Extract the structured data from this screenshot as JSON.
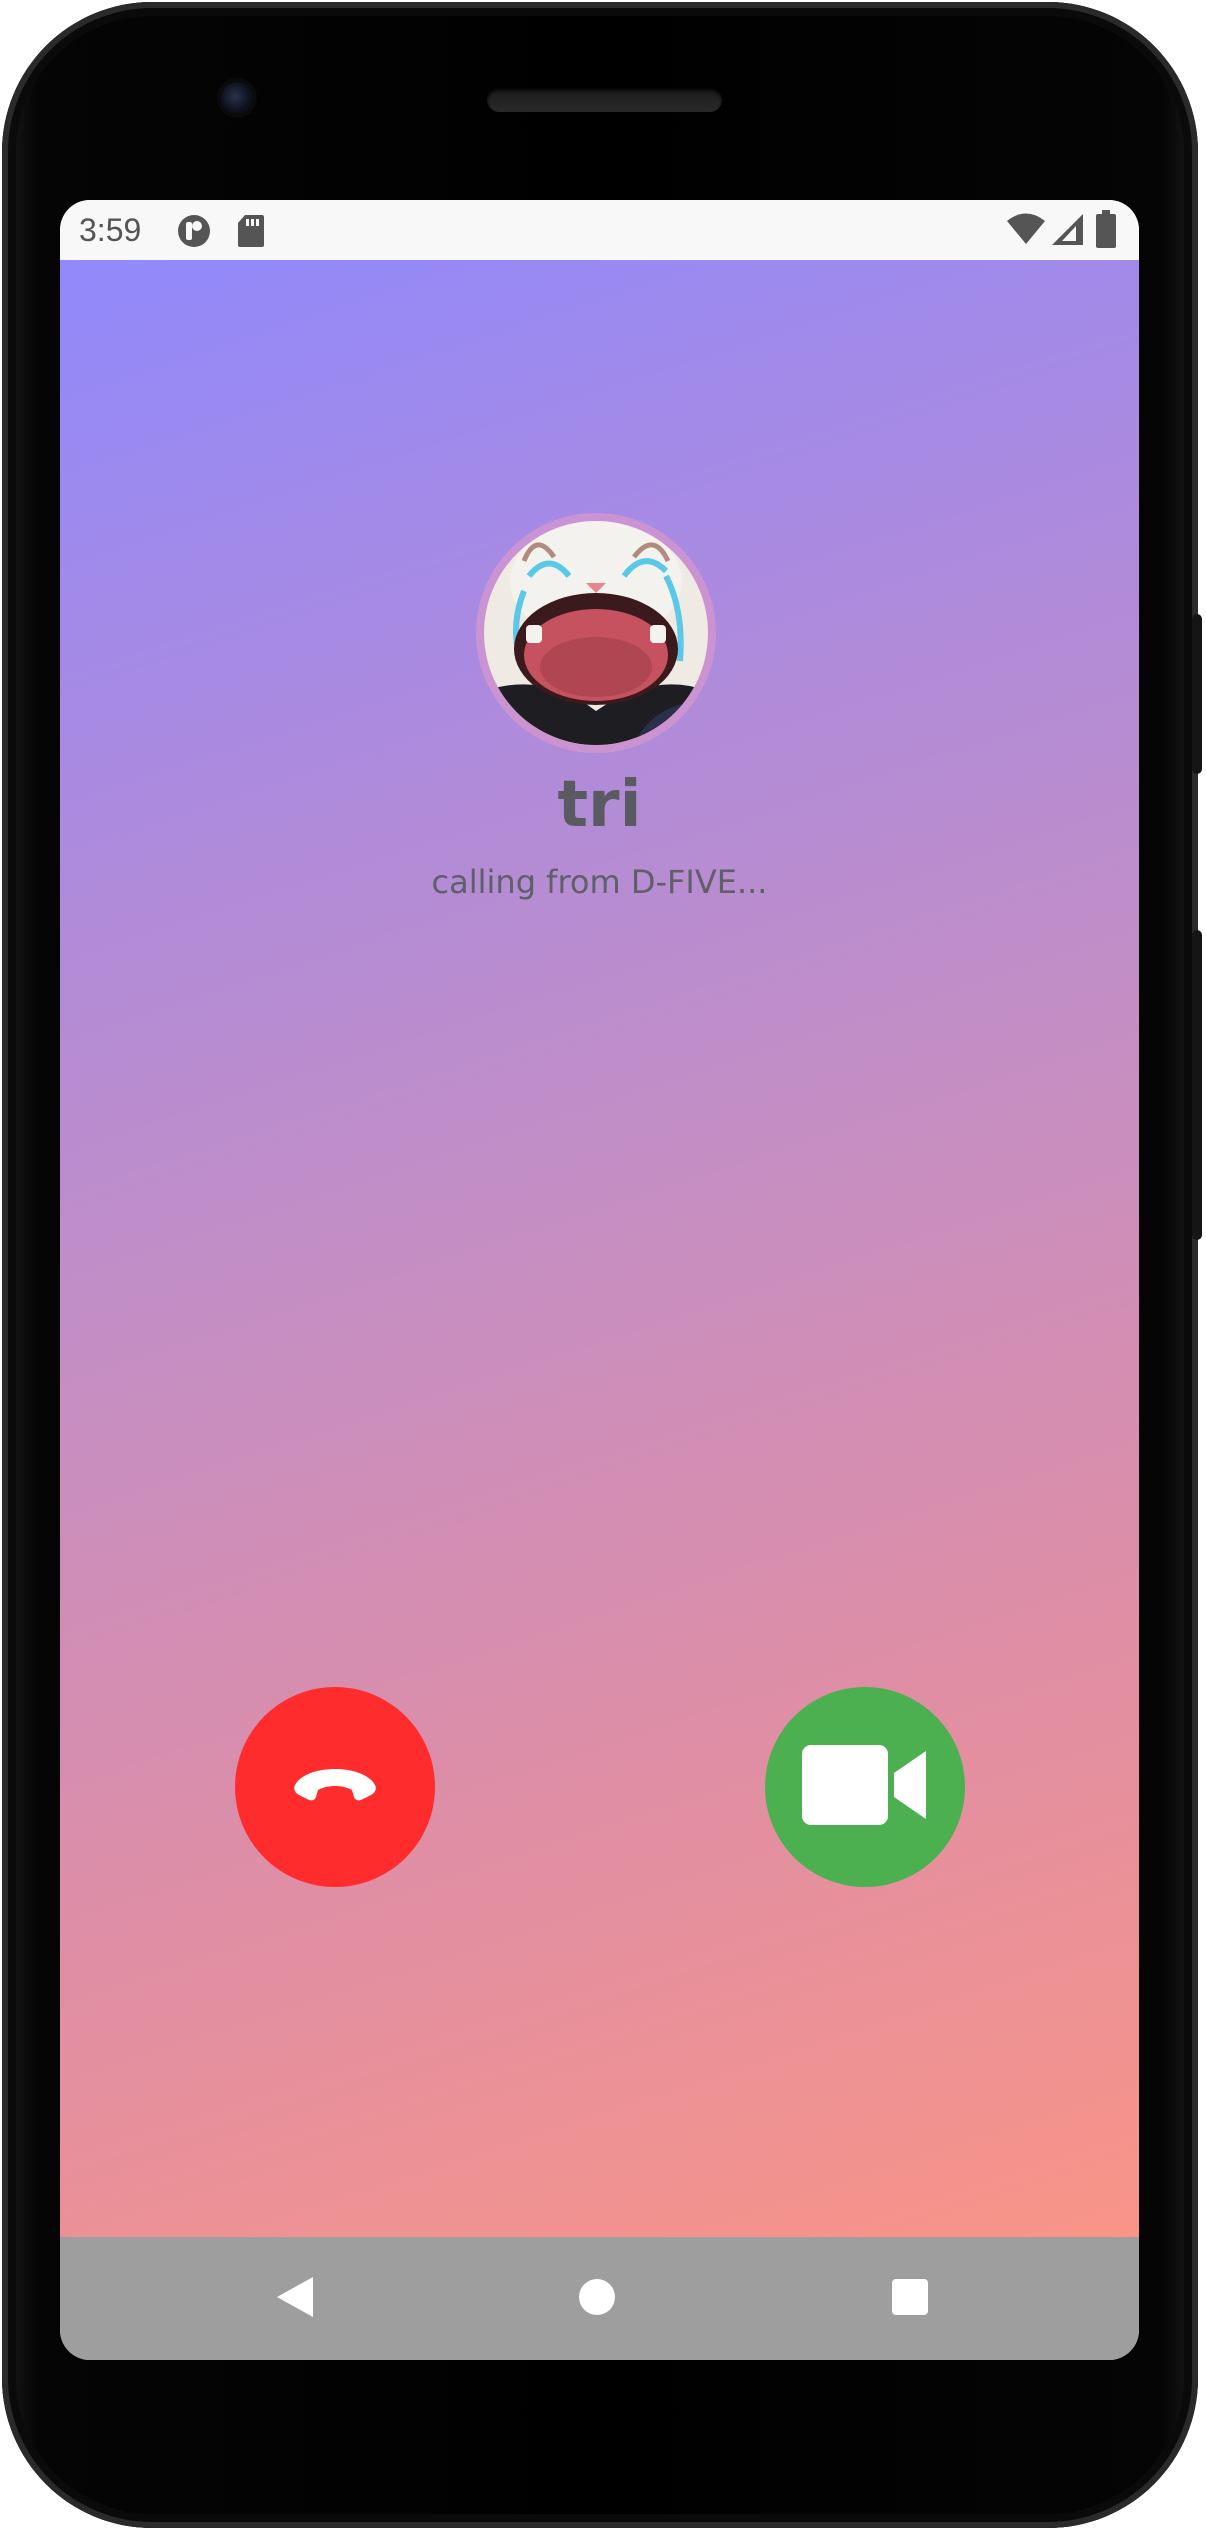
{
  "status_bar": {
    "time": "3:59",
    "icons": [
      "launcher-app-icon",
      "sd-card-icon",
      "wifi-icon",
      "signal-icon",
      "battery-icon"
    ]
  },
  "call": {
    "caller_name": "tri",
    "subtitle": "calling from D-FIVE...",
    "avatar": "crying-cat-avatar",
    "decline_icon": "phone-hangup-icon",
    "accept_icon": "video-camera-icon"
  },
  "colors": {
    "gradient_start": "#9189fb",
    "gradient_end": "#f99487",
    "decline": "#fe2c2c",
    "accept": "#4caf50",
    "navbar": "#9e9e9e"
  },
  "nav": [
    "back-icon",
    "home-icon",
    "recents-icon"
  ]
}
